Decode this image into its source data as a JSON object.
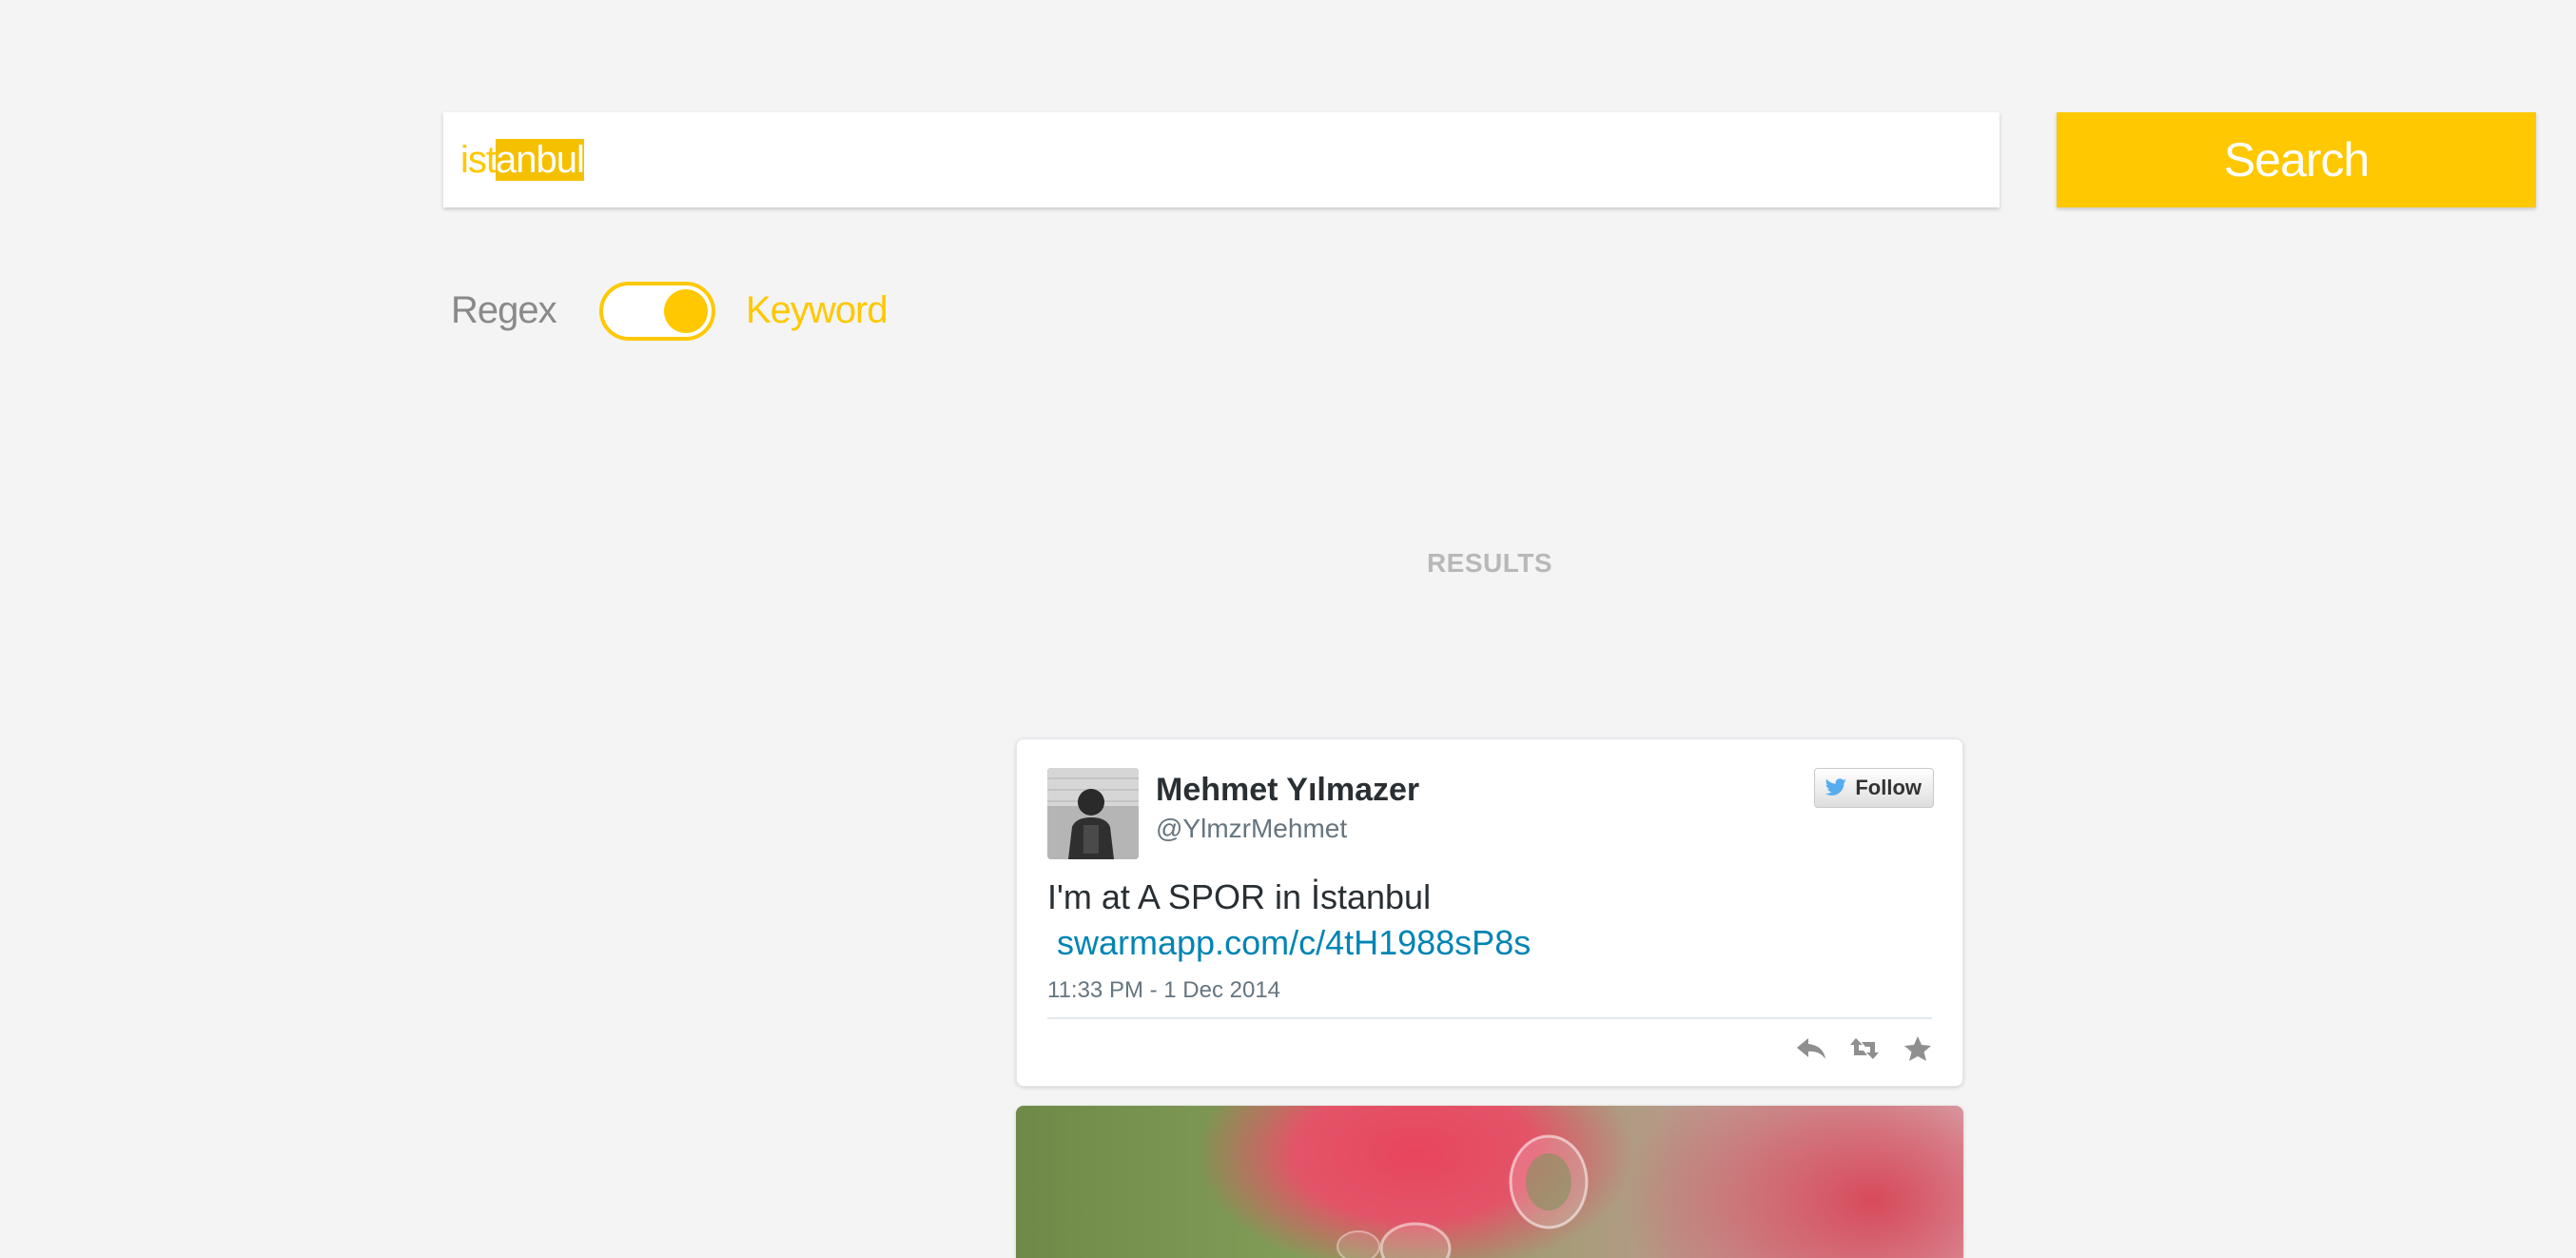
{
  "search": {
    "value_unselected": "ist",
    "value_selected": "anbul",
    "button_label": "Search"
  },
  "mode": {
    "left_label": "Regex",
    "right_label": "Keyword",
    "selected": "Keyword"
  },
  "results": {
    "heading": "RESULTS"
  },
  "tweet": {
    "author_name": "Mehmet Yılmazer",
    "author_handle": "@YlmzrMehmet",
    "follow_label": "Follow",
    "text": "I'm at A SPOR in İstanbul",
    "link": "swarmapp.com/c/4tH1988sP8s",
    "timestamp": "11:33 PM - 1 Dec 2014",
    "actions": [
      "reply-icon",
      "retweet-icon",
      "favorite-icon"
    ]
  },
  "colors": {
    "accent": "#ffc800",
    "background": "#f4f4f4",
    "link": "#0084b4",
    "muted": "#b8b8b8"
  }
}
